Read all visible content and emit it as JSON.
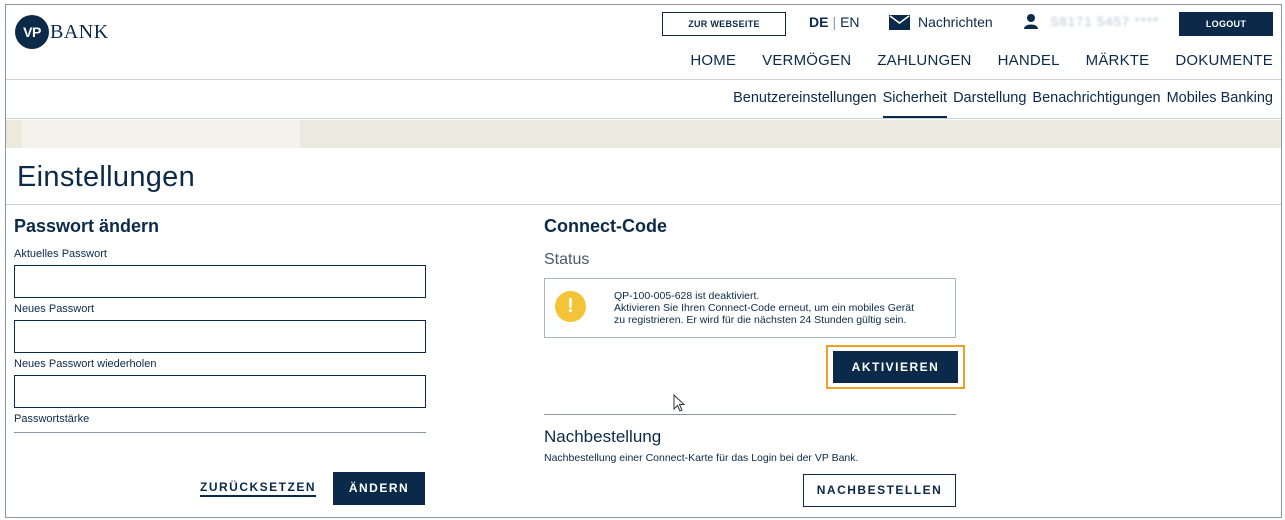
{
  "header": {
    "logo_mark": "VP",
    "logo_text": "BANK",
    "web_button": "ZUR WEBSEITE",
    "lang_de": "DE",
    "lang_sep": "|",
    "lang_en": "EN",
    "messages": "Nachrichten",
    "user_name": "S8171 5457 ****",
    "logout": "LOGOUT"
  },
  "main_nav": [
    "HOME",
    "VERMÖGEN",
    "ZAHLUNGEN",
    "HANDEL",
    "MÄRKTE",
    "DOKUMENTE"
  ],
  "sub_nav": {
    "items": [
      "Benutzereinstellungen",
      "Sicherheit",
      "Darstellung",
      "Benachrichtigungen",
      "Mobiles Banking"
    ],
    "active": "Sicherheit"
  },
  "page_title": "Einstellungen",
  "password": {
    "heading": "Passwort ändern",
    "current_label": "Aktuelles Passwort",
    "new_label": "Neues Passwort",
    "repeat_label": "Neues Passwort wiederholen",
    "strength_label": "Passwortstärke",
    "reset_button": "ZURÜCKSETZEN",
    "change_button": "ÄNDERN",
    "current_value": "",
    "new_value": "",
    "repeat_value": ""
  },
  "connect": {
    "heading": "Connect-Code",
    "status_label": "Status",
    "alert_line1": "QP-100-005-628 ist deaktiviert.",
    "alert_line2": "Aktivieren Sie Ihren Connect-Code erneut, um ein mobiles Gerät",
    "alert_line3": "zu registrieren. Er wird für die nächsten 24 Stunden gültig sein.",
    "activate_button": "AKTIVIEREN"
  },
  "reorder": {
    "heading": "Nachbestellung",
    "description": "Nachbestellung einer Connect-Karte für das Login bei der VP Bank.",
    "button": "NACHBESTELLEN"
  },
  "colors": {
    "brand": "#0b2a4a",
    "warning": "#f3c437",
    "highlight": "#f0a022",
    "band": "#ece9df"
  }
}
